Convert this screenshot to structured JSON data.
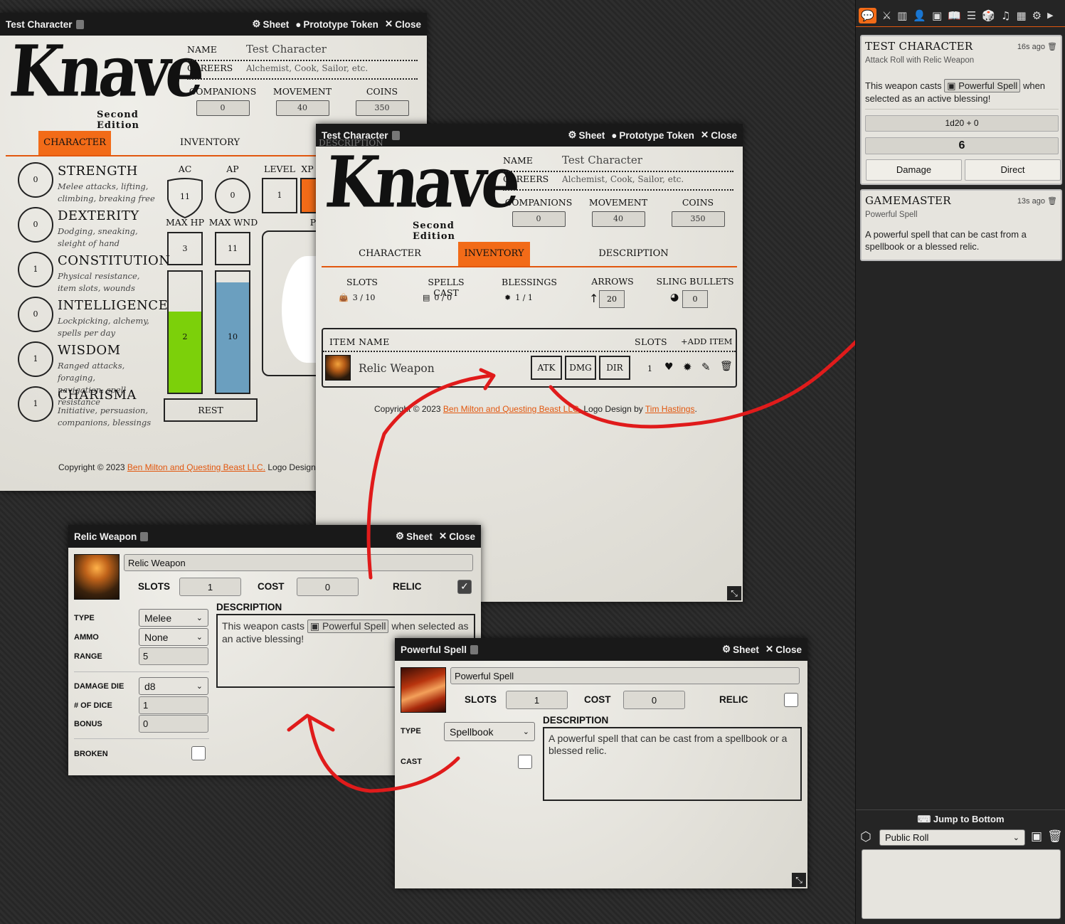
{
  "sheet1": {
    "title": "Test Character",
    "hdr": {
      "sheet": "Sheet",
      "token": "Prototype Token",
      "close": "Close"
    },
    "logo": {
      "word": "Knave",
      "edition": "Second Edition"
    },
    "name_label": "NAME",
    "name_value": "Test Character",
    "careers_label": "CAREERS",
    "careers_value": "Alchemist, Cook, Sailor, etc.",
    "companions_label": "COMPANIONS",
    "companions": "0",
    "movement_label": "MOVEMENT",
    "movement": "40",
    "coins_label": "COINS",
    "coins": "350",
    "tabs": [
      "CHARACTER",
      "INVENTORY"
    ],
    "abilities": [
      {
        "name": "STRENGTH",
        "value": "0",
        "desc1": "Melee attacks, lifting,",
        "desc2": "climbing, breaking free"
      },
      {
        "name": "DEXTERITY",
        "value": "0",
        "desc1": "Dodging, sneaking,",
        "desc2": "sleight of hand"
      },
      {
        "name": "CONSTITUTION",
        "value": "1",
        "desc1": "Physical resistance,",
        "desc2": "item slots, wounds"
      },
      {
        "name": "INTELLIGENCE",
        "value": "0",
        "desc1": "Lockpicking, alchemy,",
        "desc2": "spells per day"
      },
      {
        "name": "WISDOM",
        "value": "1",
        "desc1": "Ranged attacks, foraging,",
        "desc2": "navigation, spell resistance"
      },
      {
        "name": "CHARISMA",
        "value": "1",
        "desc1": "Initiative, persuasion,",
        "desc2": "companions, blessings"
      }
    ],
    "ac_label": "AC",
    "ac": "11",
    "ap_label": "AP",
    "ap": "0",
    "level_label": "LEVEL",
    "level": "1",
    "xp_label": "XP",
    "maxhp_label": "MAX HP",
    "maxhp": "3",
    "maxwnd_label": "MAX WND",
    "maxwnd": "11",
    "hp_current": "2",
    "hp_fraction": 0.67,
    "wnd_current": "10",
    "wnd_fraction": 0.91,
    "rest_label": "REST",
    "p_label": "P",
    "copy_pre": "Copyright © 2023",
    "copy_link1": "Ben Milton and Questing Beast LLC.",
    "copy_mid": "Logo Design by"
  },
  "sheet2": {
    "title": "Test Character",
    "ghost": "DESCRIPTION",
    "hdr": {
      "sheet": "Sheet",
      "token": "Prototype Token",
      "close": "Close"
    },
    "logo": {
      "word": "Knave",
      "edition": "Second Edition"
    },
    "name_label": "NAME",
    "name_value": "Test Character",
    "careers_label": "CAREERS",
    "careers_value": "Alchemist, Cook, Sailor, etc.",
    "companions_label": "COMPANIONS",
    "companions": "0",
    "movement_label": "MOVEMENT",
    "movement": "40",
    "coins_label": "COINS",
    "coins": "350",
    "tabs": [
      "CHARACTER",
      "INVENTORY",
      "DESCRIPTION"
    ],
    "slots_label": "SLOTS",
    "slots": "3 / 10",
    "spells_label": "SPELLS CAST",
    "spells": "0 / 0",
    "blessings_label": "BLESSINGS",
    "blessings": "1 / 1",
    "arrows_label": "ARROWS",
    "arrows": "20",
    "sling_label": "SLING BULLETS",
    "sling": "0",
    "table": {
      "item_col": "ITEM NAME",
      "slots_col": "SLOTS",
      "add": "ADD ITEM"
    },
    "item": {
      "name": "Relic Weapon",
      "atk": "ATK",
      "dmg": "DMG",
      "dir": "DIR",
      "slots": "1"
    },
    "copy_pre": "Copyright © 2023",
    "copy_link1": "Ben Milton and Questing Beast LLC.",
    "copy_mid": "Logo Design by",
    "copy_link2": "Tim Hastings",
    "copy_end": "."
  },
  "relic": {
    "title": "Relic Weapon",
    "hdr": {
      "sheet": "Sheet",
      "close": "Close"
    },
    "name": "Relic Weapon",
    "slots_label": "SLOTS",
    "slots": "1",
    "cost_label": "COST",
    "cost": "0",
    "relic_label": "RELIC",
    "relic_checked": true,
    "type_label": "TYPE",
    "type": "Melee",
    "ammo_label": "AMMO",
    "ammo": "None",
    "range_label": "RANGE",
    "range": "5",
    "die_label": "DAMAGE DIE",
    "die": "d8",
    "ndice_label": "# OF DICE",
    "ndice": "1",
    "bonus_label": "BONUS",
    "bonus": "0",
    "broken_label": "BROKEN",
    "desc_label": "DESCRIPTION",
    "desc_pre": "This weapon casts",
    "desc_chip": "Powerful Spell",
    "desc_post": "when selected as an active blessing!"
  },
  "spell": {
    "title": "Powerful Spell",
    "hdr": {
      "sheet": "Sheet",
      "close": "Close"
    },
    "name": "Powerful Spell",
    "slots_label": "SLOTS",
    "slots": "1",
    "cost_label": "COST",
    "cost": "0",
    "relic_label": "RELIC",
    "type_label": "TYPE",
    "type": "Spellbook",
    "cast_label": "CAST",
    "desc_label": "DESCRIPTION",
    "desc": "A powerful spell that can be cast from a spellbook or a blessed relic."
  },
  "chat": {
    "msg1": {
      "who": "TEST CHARACTER",
      "ago": "16s ago",
      "sub": "Attack Roll with Relic Weapon",
      "pre": "This weapon casts",
      "chip": "Powerful Spell",
      "post": "when selected as an active blessing!",
      "formula": "1d20 + 0",
      "total": "6",
      "damage": "Damage",
      "direct": "Direct"
    },
    "msg2": {
      "who": "GAMEMASTER",
      "ago": "13s ago",
      "sub": "Powerful Spell",
      "text": "A powerful spell that can be cast from a spellbook or a blessed relic."
    },
    "jump": "Jump to Bottom",
    "roll_mode": "Public Roll"
  },
  "colors": {
    "accent": "#f26b18",
    "hp": "#7cd00a",
    "wounds": "#6b9fbf",
    "annotation": "#e01b1b"
  }
}
